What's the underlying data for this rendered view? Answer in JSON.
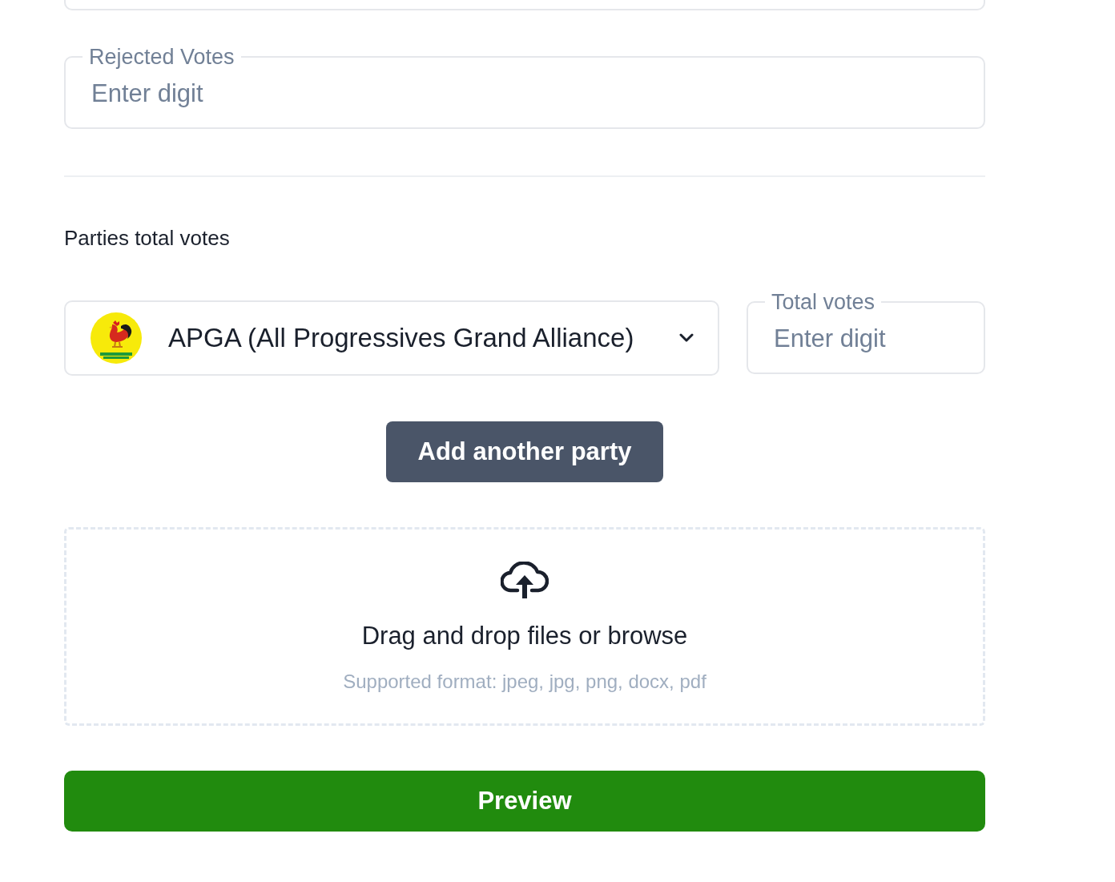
{
  "fields": [
    {
      "kind": "cut_off"
    },
    {
      "kind": "outlined",
      "label": "Rejected Votes",
      "placeholder": "Enter digit"
    }
  ],
  "section": {
    "title": "Parties total votes"
  },
  "parties": [
    {
      "party_select": {
        "value": "APGA (All Progressives Grand Alliance)"
      },
      "total_votes": {
        "label": "Total votes",
        "placeholder": "Enter digit"
      }
    }
  ],
  "add_party_button": "Add another party",
  "upload": {
    "prompt": "Drag and drop files or browse",
    "formats": "Supported format: jpeg, jpg, png, docx, pdf"
  },
  "preview_button": "Preview"
}
